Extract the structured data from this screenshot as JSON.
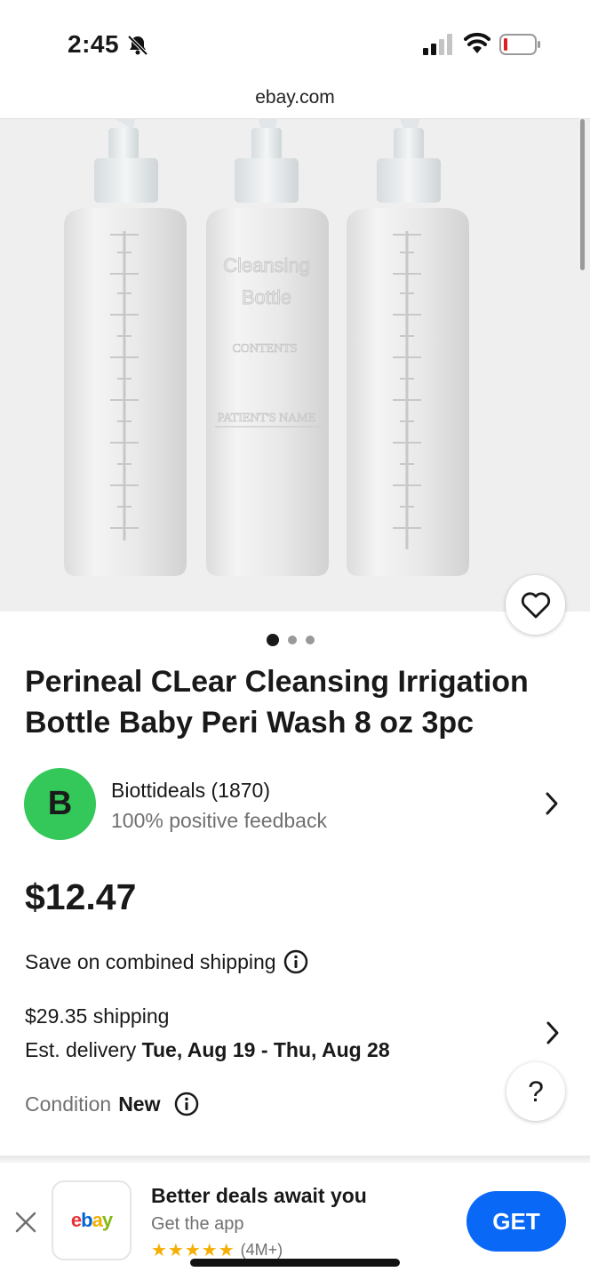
{
  "status_bar": {
    "time": "2:45",
    "icons": [
      "mute-bell-icon",
      "cellular-signal-icon",
      "wifi-icon",
      "battery-low-icon"
    ]
  },
  "browser": {
    "url": "ebay.com"
  },
  "gallery": {
    "bottle_labels": {
      "line1": "Cleansing",
      "line2": "Bottle",
      "contents": "CONTENTS",
      "patient": "PATIENT'S NAME"
    },
    "image_count": 3,
    "active_index": 0
  },
  "product": {
    "title": "Perineal CLear Cleansing Irrigation Bottle Baby Peri Wash 8 oz 3pc",
    "price": "$12.47",
    "combined_shipping": "Save on combined shipping",
    "shipping_cost": "$29.35 shipping",
    "delivery_prefix": "Est. delivery",
    "delivery_dates": "Tue, Aug 19 - Thu, Aug 28",
    "condition_label": "Condition",
    "condition_value": "New"
  },
  "seller": {
    "initial": "B",
    "name": "Biottideals (1870)",
    "feedback": "100% positive feedback",
    "avatar_color": "#34c759"
  },
  "help": {
    "label": "?"
  },
  "app_banner": {
    "logo_letters": [
      "e",
      "b",
      "a",
      "y"
    ],
    "title": "Better deals await you",
    "subtitle": "Get the app",
    "stars": "★★★★★",
    "rating_count": "(4M+)",
    "get_label": "GET",
    "button_color": "#0968f6"
  }
}
